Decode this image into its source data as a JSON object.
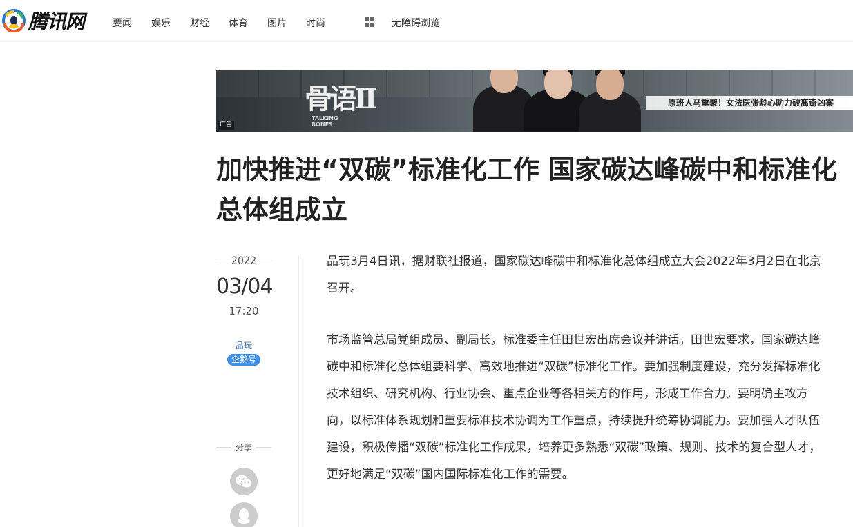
{
  "brand": {
    "logo_text": "腾讯网"
  },
  "nav": {
    "items": [
      "要闻",
      "娱乐",
      "财经",
      "体育",
      "图片",
      "时尚"
    ],
    "accessibility": "无障碍浏览"
  },
  "ad": {
    "show_logo": "骨语II",
    "show_logo_en": "TALKING BONES",
    "slogan": "原班人马重聚！女法医张龄心助力破离奇凶案",
    "tag": "广告"
  },
  "article": {
    "title": "加快推进“双碳”标准化工作 国家碳达峰碳中和标准化总体组成立",
    "year": "2022",
    "date": "03/04",
    "time": "17:20",
    "author": "品玩",
    "author_badge": "企鹅号",
    "share_label": "分享",
    "paragraphs": [
      "品玩3月4日讯，据财联社报道，国家碳达峰碳中和标准化总体组成立大会2022年3月2日在北京召开。",
      "市场监管总局党组成员、副局长，标准委主任田世宏出席会议并讲话。田世宏要求，国家碳达峰碳中和标准化总体组要科学、高效地推进“双碳”标准化工作。要加强制度建设，充分发挥标准化技术组织、研究机构、行业协会、重点企业等各相关方的作用，形成工作合力。要明确主攻方向，以标准体系规划和重要标准技术协调为工作重点，持续提升统筹协调能力。要加强人才队伍建设，积极传播“双碳”标准化工作成果，培养更多熟悉“双碳”政策、规则、技术的复合型人才，更好地满足“双碳”国内国际标准化工作的需要。"
    ]
  },
  "colors": {
    "accent_blue": "#3f8ee8",
    "author_blue": "#3f74c3",
    "title_text": "#222222"
  },
  "icons": {
    "share_1": "wechat-icon",
    "share_2": "qq-icon"
  }
}
